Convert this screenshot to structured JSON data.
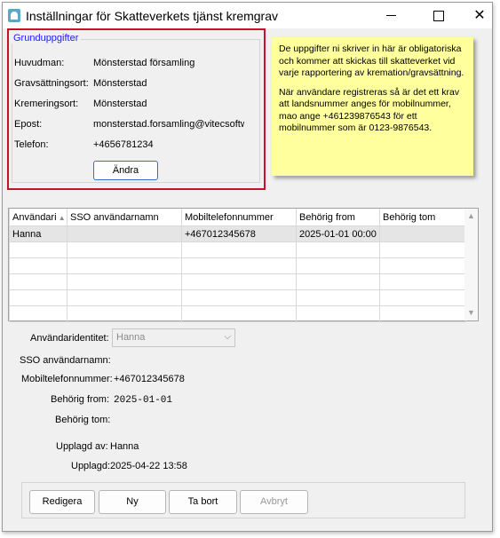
{
  "window": {
    "title": "Inställningar för Skatteverkets tjänst kremgrav",
    "minimize": "—",
    "maximize": "☐",
    "close": "✕"
  },
  "basic_info": {
    "legend": "Grunduppgifter",
    "fields": [
      {
        "label": "Huvudman:",
        "value": "Mönsterstad församling"
      },
      {
        "label": "Gravsättningsort:",
        "value": "Mönsterstad"
      },
      {
        "label": "Kremeringsort:",
        "value": "Mönsterstad"
      },
      {
        "label": "Epost:",
        "value": "monsterstad.forsamling@vitecsoftware"
      },
      {
        "label": "Telefon:",
        "value": "+4656781234"
      }
    ],
    "change_button": "Ändra"
  },
  "note": {
    "paragraph1": "De uppgifter ni skriver in här är obligatoriska och kommer att skickas till skatteverket vid varje rapportering av kremation/gravsättning.",
    "paragraph2": "När användare registreras så är det ett krav att landsnummer anges för mobilnummer, mao ange +461239876543 för ett mobilnummer som är 0123-9876543."
  },
  "users_table": {
    "columns": [
      "Användari",
      "SSO användarnamn",
      "Mobiltelefonnummer",
      "Behörig from",
      "Behörig tom"
    ],
    "rows": [
      [
        "Hanna",
        "",
        "+467012345678",
        "2025-01-01 00:00",
        ""
      ]
    ]
  },
  "details": {
    "user_identity_label": "Användaridentitet:",
    "user_identity_value": "Hanna",
    "sso_label": "SSO användarnamn:",
    "sso_value": "",
    "mobile_label": "Mobiltelefonnummer:",
    "mobile_value": "+467012345678",
    "from_label": "Behörig from:",
    "from_value": "2025-01-01",
    "to_label": "Behörig tom:",
    "to_value": "",
    "created_by_label": "Upplagd av:",
    "created_by_value": "Hanna",
    "created_label": "Upplagd:",
    "created_value": "2025-04-22 13:58"
  },
  "actions": {
    "edit": "Redigera",
    "new": "Ny",
    "delete": "Ta bort",
    "cancel": "Avbryt"
  }
}
